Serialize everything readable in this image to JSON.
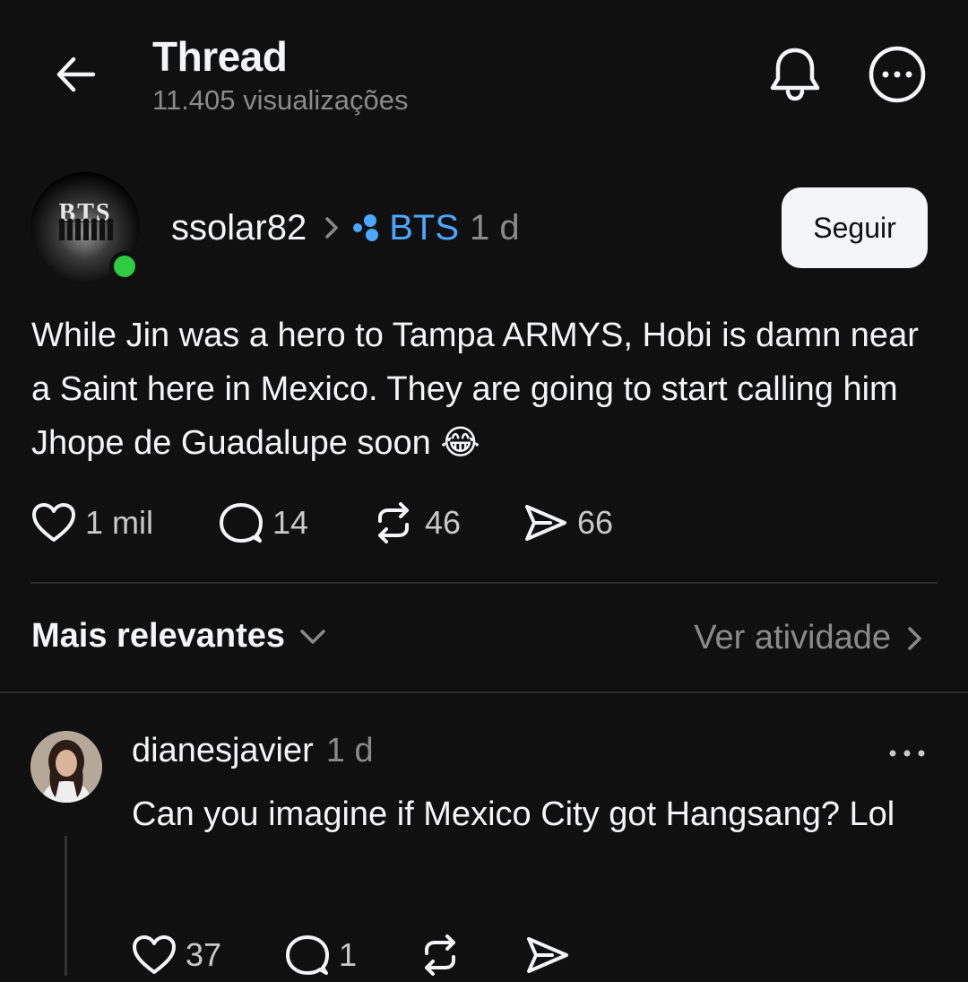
{
  "header": {
    "title": "Thread",
    "views": "11.405 visualizações",
    "back_icon": "arrow-left-icon",
    "bell_icon": "bell-icon",
    "more_icon": "more-circle-icon"
  },
  "post": {
    "author": "ssolar82",
    "community": "BTS",
    "time": "1 d",
    "follow_label": "Seguir",
    "avatar_text": "BTS",
    "text": "While Jin was a hero to Tampa ARMYS,  Hobi is damn near a Saint here in Mexico. They are going to start calling him Jhope de Guadalupe  soon 😂",
    "likes": "1 mil",
    "comments": "14",
    "reposts": "46",
    "shares": "66"
  },
  "sort": {
    "label": "Mais relevantes",
    "activity_label": "Ver atividade"
  },
  "reply": {
    "author": "dianesjavier",
    "time": "1 d",
    "text": "Can you imagine if Mexico City got Hangsang? Lol",
    "likes": "37",
    "comments": "1"
  },
  "colors": {
    "background": "#101010",
    "link_blue": "#4aa8ff",
    "online_green": "#2ecc40"
  }
}
